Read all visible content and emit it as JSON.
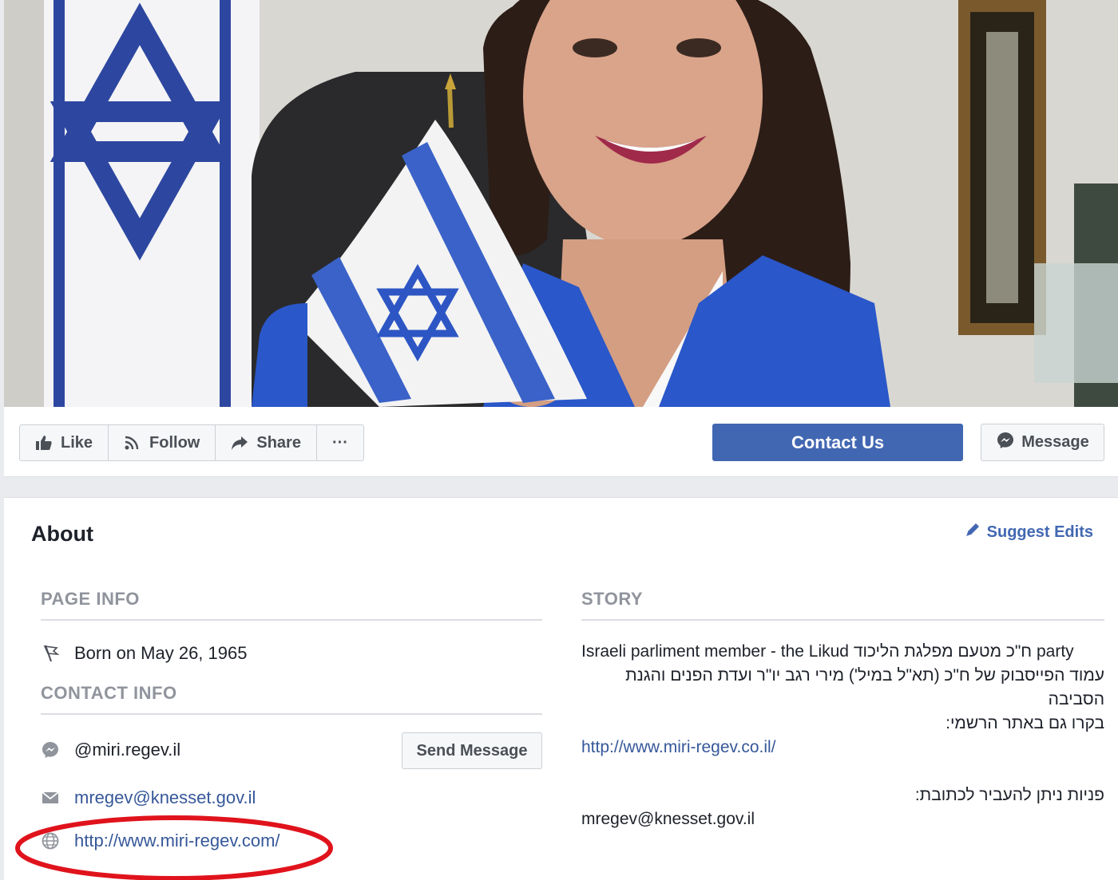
{
  "actions": {
    "like": "Like",
    "follow": "Follow",
    "share": "Share",
    "more": "···",
    "contact_us": "Contact Us",
    "message": "Message"
  },
  "about": {
    "title": "About",
    "suggest_edits": "Suggest Edits",
    "page_info_heading": "PAGE INFO",
    "born": "Born on May 26, 1965",
    "contact_info_heading": "CONTACT INFO",
    "messenger_handle": "@miri.regev.il",
    "send_message": "Send Message",
    "email": "mregev@knesset.gov.il",
    "website": "http://www.miri-regev.com/"
  },
  "story": {
    "heading": "STORY",
    "line1": "Israeli parliment member - the Likud ח\"כ מטעם מפלגת הליכוד party",
    "line2": "עמוד הפייסבוק של ח\"כ (תא\"ל במיל') מירי רגב יו\"ר ועדת הפנים והגנת הסביבה",
    "line3": "בקרו גם באתר הרשמי:",
    "line4": "http://www.miri-regev.co.il/",
    "line5": "פניות ניתן להעביר לכתובת:",
    "line6": "mregev@knesset.gov.il"
  },
  "colors": {
    "accent": "#4267b2",
    "link": "#365899",
    "annotation": "#e0131c"
  },
  "icons": {
    "like": "thumbs-up-icon",
    "follow": "rss-icon",
    "share": "share-arrow-icon",
    "message": "messenger-icon",
    "edit": "pencil-icon",
    "born": "flag-icon",
    "messenger": "messenger-icon",
    "email": "envelope-icon",
    "website": "globe-icon"
  }
}
